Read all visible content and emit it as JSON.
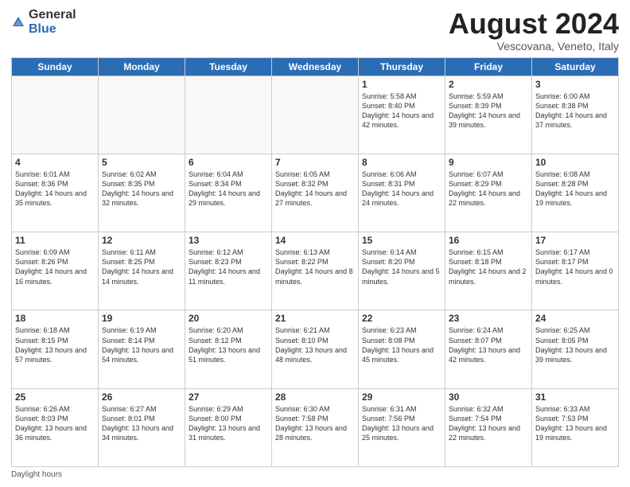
{
  "logo": {
    "general": "General",
    "blue": "Blue"
  },
  "header": {
    "month_year": "August 2024",
    "subtitle": "Vescovana, Veneto, Italy"
  },
  "days_of_week": [
    "Sunday",
    "Monday",
    "Tuesday",
    "Wednesday",
    "Thursday",
    "Friday",
    "Saturday"
  ],
  "weeks": [
    [
      {
        "day": "",
        "info": ""
      },
      {
        "day": "",
        "info": ""
      },
      {
        "day": "",
        "info": ""
      },
      {
        "day": "",
        "info": ""
      },
      {
        "day": "1",
        "info": "Sunrise: 5:58 AM\nSunset: 8:40 PM\nDaylight: 14 hours and 42 minutes."
      },
      {
        "day": "2",
        "info": "Sunrise: 5:59 AM\nSunset: 8:39 PM\nDaylight: 14 hours and 39 minutes."
      },
      {
        "day": "3",
        "info": "Sunrise: 6:00 AM\nSunset: 8:38 PM\nDaylight: 14 hours and 37 minutes."
      }
    ],
    [
      {
        "day": "4",
        "info": "Sunrise: 6:01 AM\nSunset: 8:36 PM\nDaylight: 14 hours and 35 minutes."
      },
      {
        "day": "5",
        "info": "Sunrise: 6:02 AM\nSunset: 8:35 PM\nDaylight: 14 hours and 32 minutes."
      },
      {
        "day": "6",
        "info": "Sunrise: 6:04 AM\nSunset: 8:34 PM\nDaylight: 14 hours and 29 minutes."
      },
      {
        "day": "7",
        "info": "Sunrise: 6:05 AM\nSunset: 8:32 PM\nDaylight: 14 hours and 27 minutes."
      },
      {
        "day": "8",
        "info": "Sunrise: 6:06 AM\nSunset: 8:31 PM\nDaylight: 14 hours and 24 minutes."
      },
      {
        "day": "9",
        "info": "Sunrise: 6:07 AM\nSunset: 8:29 PM\nDaylight: 14 hours and 22 minutes."
      },
      {
        "day": "10",
        "info": "Sunrise: 6:08 AM\nSunset: 8:28 PM\nDaylight: 14 hours and 19 minutes."
      }
    ],
    [
      {
        "day": "11",
        "info": "Sunrise: 6:09 AM\nSunset: 8:26 PM\nDaylight: 14 hours and 16 minutes."
      },
      {
        "day": "12",
        "info": "Sunrise: 6:11 AM\nSunset: 8:25 PM\nDaylight: 14 hours and 14 minutes."
      },
      {
        "day": "13",
        "info": "Sunrise: 6:12 AM\nSunset: 8:23 PM\nDaylight: 14 hours and 11 minutes."
      },
      {
        "day": "14",
        "info": "Sunrise: 6:13 AM\nSunset: 8:22 PM\nDaylight: 14 hours and 8 minutes."
      },
      {
        "day": "15",
        "info": "Sunrise: 6:14 AM\nSunset: 8:20 PM\nDaylight: 14 hours and 5 minutes."
      },
      {
        "day": "16",
        "info": "Sunrise: 6:15 AM\nSunset: 8:18 PM\nDaylight: 14 hours and 2 minutes."
      },
      {
        "day": "17",
        "info": "Sunrise: 6:17 AM\nSunset: 8:17 PM\nDaylight: 14 hours and 0 minutes."
      }
    ],
    [
      {
        "day": "18",
        "info": "Sunrise: 6:18 AM\nSunset: 8:15 PM\nDaylight: 13 hours and 57 minutes."
      },
      {
        "day": "19",
        "info": "Sunrise: 6:19 AM\nSunset: 8:14 PM\nDaylight: 13 hours and 54 minutes."
      },
      {
        "day": "20",
        "info": "Sunrise: 6:20 AM\nSunset: 8:12 PM\nDaylight: 13 hours and 51 minutes."
      },
      {
        "day": "21",
        "info": "Sunrise: 6:21 AM\nSunset: 8:10 PM\nDaylight: 13 hours and 48 minutes."
      },
      {
        "day": "22",
        "info": "Sunrise: 6:23 AM\nSunset: 8:08 PM\nDaylight: 13 hours and 45 minutes."
      },
      {
        "day": "23",
        "info": "Sunrise: 6:24 AM\nSunset: 8:07 PM\nDaylight: 13 hours and 42 minutes."
      },
      {
        "day": "24",
        "info": "Sunrise: 6:25 AM\nSunset: 8:05 PM\nDaylight: 13 hours and 39 minutes."
      }
    ],
    [
      {
        "day": "25",
        "info": "Sunrise: 6:26 AM\nSunset: 8:03 PM\nDaylight: 13 hours and 36 minutes."
      },
      {
        "day": "26",
        "info": "Sunrise: 6:27 AM\nSunset: 8:01 PM\nDaylight: 13 hours and 34 minutes."
      },
      {
        "day": "27",
        "info": "Sunrise: 6:29 AM\nSunset: 8:00 PM\nDaylight: 13 hours and 31 minutes."
      },
      {
        "day": "28",
        "info": "Sunrise: 6:30 AM\nSunset: 7:58 PM\nDaylight: 13 hours and 28 minutes."
      },
      {
        "day": "29",
        "info": "Sunrise: 6:31 AM\nSunset: 7:56 PM\nDaylight: 13 hours and 25 minutes."
      },
      {
        "day": "30",
        "info": "Sunrise: 6:32 AM\nSunset: 7:54 PM\nDaylight: 13 hours and 22 minutes."
      },
      {
        "day": "31",
        "info": "Sunrise: 6:33 AM\nSunset: 7:53 PM\nDaylight: 13 hours and 19 minutes."
      }
    ]
  ],
  "footer": {
    "daylight_hours_label": "Daylight hours"
  }
}
